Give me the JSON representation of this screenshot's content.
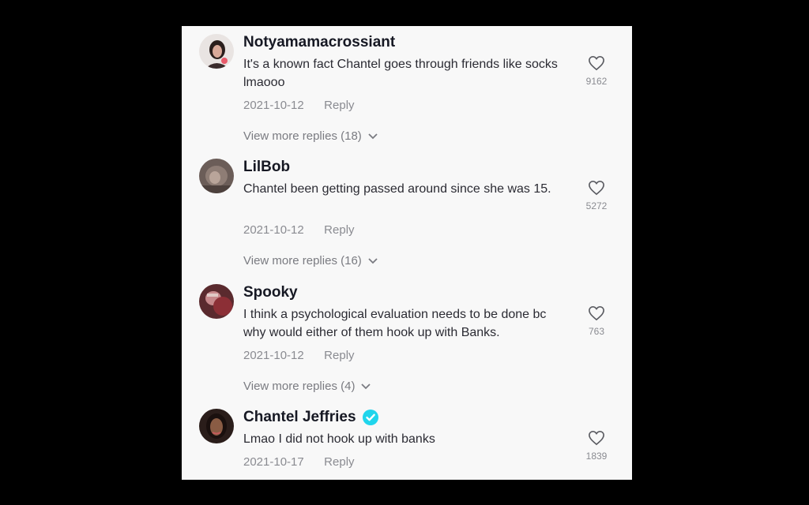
{
  "comments": [
    {
      "username": "Notyamamacrossiant",
      "text": "It's a known fact Chantel goes through friends like socks lmaooo",
      "date": "2021-10-12",
      "reply": "Reply",
      "likes": "9162",
      "more_replies": "View more replies (18)",
      "verified": false
    },
    {
      "username": "LilBob",
      "text": "Chantel been getting passed around since she was 15.",
      "date": "2021-10-12",
      "reply": "Reply",
      "likes": "5272",
      "more_replies": "View more replies (16)",
      "verified": false
    },
    {
      "username": "Spooky",
      "text": "I think a psychological evaluation needs to be done bc why would either of them hook up with Banks.",
      "date": "2021-10-12",
      "reply": "Reply",
      "likes": "763",
      "more_replies": "View more replies (4)",
      "verified": false
    },
    {
      "username": "Chantel Jeffries",
      "text": "Lmao I did not hook up with banks",
      "date": "2021-10-17",
      "reply": "Reply",
      "likes": "1839",
      "verified": true
    }
  ],
  "colors": {
    "panel_bg": "#f8f8f8",
    "text_primary": "#161823",
    "text_secondary": "#8a8b91",
    "verified_badge": "#20d5ec"
  }
}
